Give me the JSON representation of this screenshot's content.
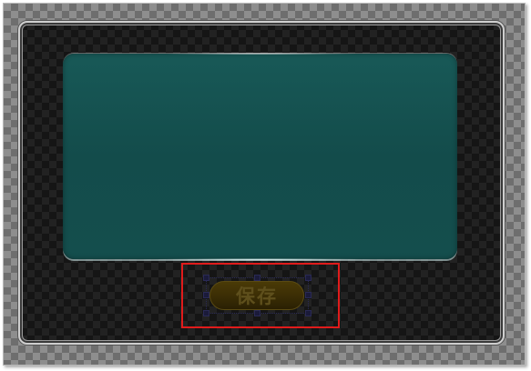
{
  "window": {
    "save_label": "保存"
  },
  "colors": {
    "screen_fill": "#134c4b",
    "panel_fill": "#151515",
    "button_fill": "#3a2d05",
    "button_text": "#5e4f1c",
    "selection_border": "#e01b1b"
  }
}
